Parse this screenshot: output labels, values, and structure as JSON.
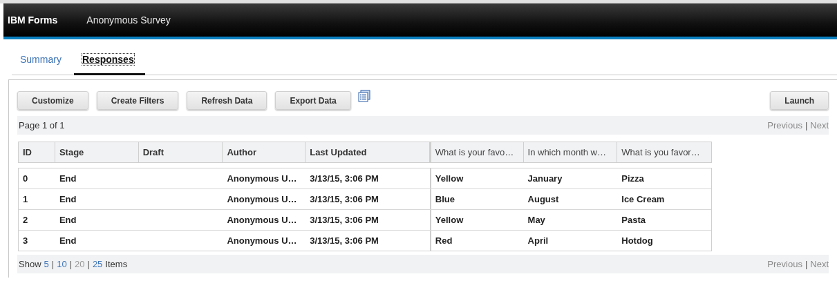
{
  "header": {
    "product": "IBM Forms",
    "title": "Anonymous Survey"
  },
  "tabs": [
    {
      "label": "Summary",
      "selected": false
    },
    {
      "label": "Responses",
      "selected": true
    }
  ],
  "toolbar": {
    "buttons": [
      "Customize",
      "Create Filters",
      "Refresh Data",
      "Export Data"
    ],
    "launch": "Launch"
  },
  "pager_top": {
    "page": "Page 1 of 1",
    "previous": "Previous",
    "separator": "|",
    "next": "Next"
  },
  "table": {
    "columns": [
      {
        "label": "ID",
        "kind": "fixed"
      },
      {
        "label": "Stage",
        "kind": "fixed"
      },
      {
        "label": "Draft",
        "kind": "fixed"
      },
      {
        "label": "Author",
        "kind": "fixed"
      },
      {
        "label": "Last Updated",
        "kind": "fixed"
      },
      {
        "label": "What is your favo…",
        "kind": "question"
      },
      {
        "label": "In which month w…",
        "kind": "question"
      },
      {
        "label": "What is you favor…",
        "kind": "question"
      }
    ],
    "rows": [
      [
        "0",
        "End",
        "",
        "Anonymous U…",
        "3/13/15, 3:06 PM",
        "Yellow",
        "January",
        "Pizza"
      ],
      [
        "1",
        "End",
        "",
        "Anonymous U…",
        "3/13/15, 3:06 PM",
        "Blue",
        "August",
        "Ice Cream"
      ],
      [
        "2",
        "End",
        "",
        "Anonymous U…",
        "3/13/15, 3:06 PM",
        "Yellow",
        "May",
        "Pasta"
      ],
      [
        "3",
        "End",
        "",
        "Anonymous U…",
        "3/13/15, 3:06 PM",
        "Red",
        "April",
        "Hotdog"
      ]
    ]
  },
  "pager_bottom": {
    "show": "Show",
    "sizes": [
      {
        "label": "5",
        "selected": false
      },
      {
        "label": "10",
        "selected": false
      },
      {
        "label": "20",
        "selected": true
      },
      {
        "label": "25",
        "selected": false
      }
    ],
    "separator": "|",
    "items": "Items",
    "previous": "Previous",
    "next": "Next"
  }
}
